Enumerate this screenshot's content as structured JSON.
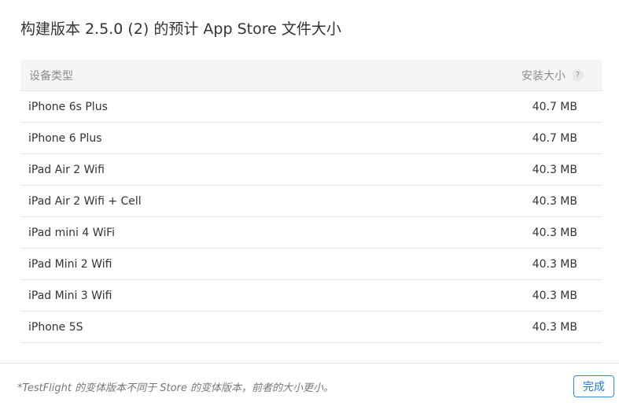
{
  "dialog": {
    "title": "构建版本 2.5.0 (2) 的预计 App Store 文件大小"
  },
  "table": {
    "columns": {
      "device": "设备类型",
      "size": "安装大小"
    },
    "help_icon_glyph": "?",
    "rows": [
      {
        "device": "iPhone 6s Plus",
        "size": "40.7 MB"
      },
      {
        "device": "iPhone 6 Plus",
        "size": "40.7 MB"
      },
      {
        "device": "iPad Air 2 Wifi",
        "size": "40.3 MB"
      },
      {
        "device": "iPad Air 2 Wifi + Cell",
        "size": "40.3 MB"
      },
      {
        "device": "iPad mini 4 WiFi",
        "size": "40.3 MB"
      },
      {
        "device": "iPad Mini 2 Wifi",
        "size": "40.3 MB"
      },
      {
        "device": "iPad Mini 3 Wifi",
        "size": "40.3 MB"
      },
      {
        "device": "iPhone 5S",
        "size": "40.3 MB"
      }
    ]
  },
  "footer": {
    "note": "*TestFlight 的变体版本不同于 Store 的变体版本，前者的大小更小。",
    "done_label": "完成"
  },
  "colors": {
    "accent": "#2d8cf0",
    "header_bg": "#f5f5f5",
    "divider": "#e6e6e6"
  }
}
